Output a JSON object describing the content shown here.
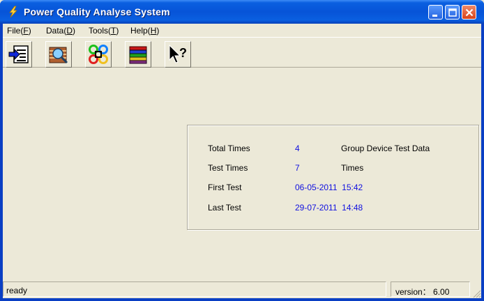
{
  "window": {
    "title": "Power Quality Analyse System"
  },
  "menu": [
    {
      "pre": "File(",
      "acc": "F",
      "post": ")"
    },
    {
      "pre": "Data(",
      "acc": "D",
      "post": ")"
    },
    {
      "pre": "Tools(",
      "acc": "T",
      "post": ")"
    },
    {
      "pre": "Help(",
      "acc": "H",
      "post": ")"
    }
  ],
  "toolbar": {
    "buttons": [
      "import-icon",
      "search-data-icon",
      "tools-icon",
      "database-icon",
      "help-pointer-icon"
    ]
  },
  "info": {
    "total_times": {
      "label": "Total Times",
      "value": "4",
      "unit": "Group Device Test Data"
    },
    "test_times": {
      "label": "Test Times",
      "value": "7",
      "unit": "Times"
    },
    "first_test": {
      "label": "First Test",
      "value": "06-05-2011  15:42"
    },
    "last_test": {
      "label": "Last Test",
      "value": "29-07-2011  14:48"
    }
  },
  "status": {
    "message": "ready",
    "version": "version： 6.00"
  },
  "colors": {
    "title_bar": "#0754d8",
    "value_text": "#1010e0",
    "background": "#ece9d8"
  }
}
